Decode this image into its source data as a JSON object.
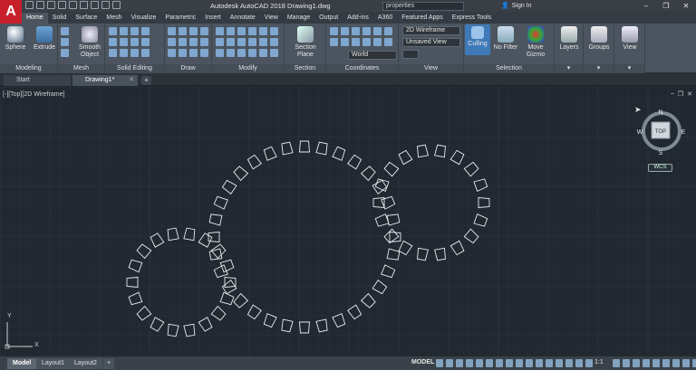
{
  "app": {
    "logo_letter": "A",
    "title": "Autodesk AutoCAD 2018   Drawing1.dwg",
    "search_value": "properties",
    "signin_label": "Sign In"
  },
  "ribbon_tabs": [
    "Home",
    "Solid",
    "Surface",
    "Mesh",
    "Visualize",
    "Parametric",
    "Insert",
    "Annotate",
    "View",
    "Manage",
    "Output",
    "Add-ins",
    "A360",
    "Featured Apps",
    "Express Tools"
  ],
  "ribbon": {
    "sphere_label": "Sphere",
    "extrude_label": "Extrude",
    "smooth_object_label": "Smooth Object",
    "section_plane_label": "Section Plane",
    "culling_label": "Culling",
    "no_filter_label": "No Filter",
    "move_gizmo_label": "Move Gizmo",
    "layers_label": "Layers",
    "groups_label": "Groups",
    "view_label": "View",
    "visual_style_value": "2D Wireframe",
    "saved_view_value": "Unsaved View",
    "ucs_value": "World",
    "panels": {
      "modeling": "Modeling",
      "mesh": "Mesh",
      "solid_editing": "Solid Editing",
      "draw": "Draw",
      "modify": "Modify",
      "section": "Section",
      "coordinates": "Coordinates",
      "view": "View",
      "selection": "Selection"
    }
  },
  "file_tabs": {
    "start": "Start",
    "drawing": "Drawing1*"
  },
  "viewport": {
    "label": "[-][Top][2D Wireframe]",
    "cube_face": "TOP",
    "compass": {
      "n": "N",
      "s": "S",
      "e": "E",
      "w": "W"
    },
    "wcs": "WCS",
    "ucs_y": "Y",
    "ucs_x": "X"
  },
  "status": {
    "layout_tabs": [
      "Model",
      "Layout1",
      "Layout2"
    ],
    "model_space": "MODEL",
    "scale": "1:1"
  },
  "colors": {
    "canvas": "#212830",
    "ribbon": "#4c555f",
    "accent_red": "#c8202b"
  }
}
